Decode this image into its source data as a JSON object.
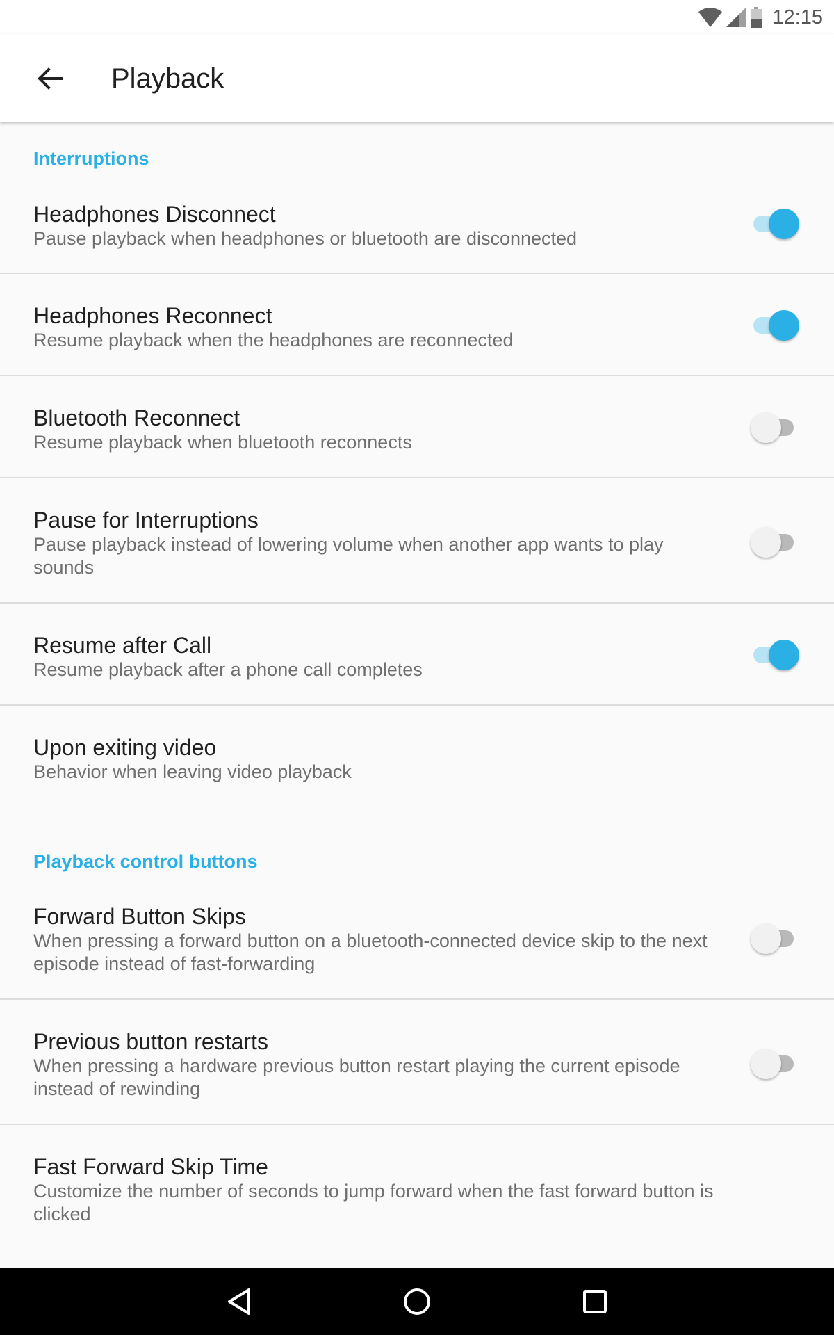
{
  "status_bar": {
    "time": "12:15"
  },
  "app_bar": {
    "title": "Playback"
  },
  "sections": {
    "interruptions": "Interruptions",
    "playback_controls": "Playback control buttons"
  },
  "settings": [
    {
      "title": "Headphones Disconnect",
      "subtitle": "Pause playback when headphones or bluetooth are disconnected",
      "enabled": true
    },
    {
      "title": "Headphones Reconnect",
      "subtitle": "Resume playback when the headphones are reconnected",
      "enabled": true
    },
    {
      "title": "Bluetooth Reconnect",
      "subtitle": "Resume playback when bluetooth reconnects",
      "enabled": false
    },
    {
      "title": "Pause for Interruptions",
      "subtitle": "Pause playback instead of lowering volume when another app wants to play sounds",
      "enabled": false
    },
    {
      "title": "Resume after Call",
      "subtitle": "Resume playback after a phone call completes",
      "enabled": true
    },
    {
      "title": "Upon exiting video",
      "subtitle": "Behavior when leaving video playback"
    },
    {
      "title": "Forward Button Skips",
      "subtitle": "When pressing a forward button on a bluetooth-connected device skip to the next episode instead of fast-forwarding",
      "enabled": false
    },
    {
      "title": "Previous button restarts",
      "subtitle": "When pressing a hardware previous button restart playing the current episode instead of rewinding",
      "enabled": false
    },
    {
      "title": "Fast Forward Skip Time",
      "subtitle": "Customize the number of seconds to jump forward when the fast forward button is clicked"
    }
  ],
  "colors": {
    "accent": "#2ab0e4",
    "switch_on_track": "#b6e4f5",
    "switch_off_thumb": "#f1f1f1",
    "switch_off_track": "#b9b9b9",
    "background": "#fafafa"
  },
  "icons": {
    "status": [
      "wifi-icon",
      "cell-signal-icon",
      "battery-icon"
    ],
    "back": "arrow-back-icon",
    "nav": [
      "nav-back-icon",
      "nav-home-icon",
      "nav-recents-icon"
    ]
  }
}
